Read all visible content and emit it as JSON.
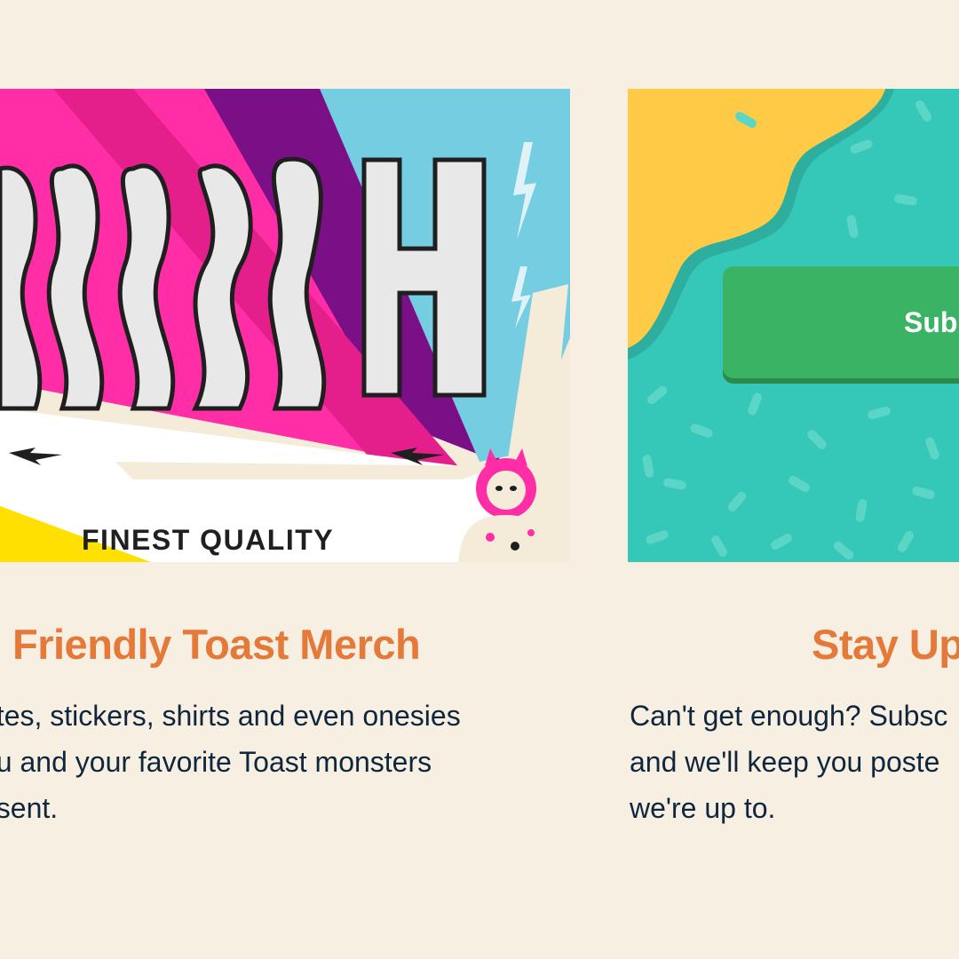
{
  "merch_card": {
    "image_caption": "FINEST QUALITY",
    "title": "Friendly Toast Merch",
    "description": [
      "otes, stickers, shirts and even onesies",
      "ou and your favorite Toast monsters",
      "esent."
    ]
  },
  "subscribe_card": {
    "button_label": "Sub",
    "title": "Stay Up",
    "description": [
      "Can't get enough? Subsc",
      "and we'll keep you poste",
      "we're up to."
    ]
  },
  "colors": {
    "background": "#f6efe2",
    "title": "#e5793a",
    "body_text": "#10263c",
    "button": "#3ab464"
  }
}
